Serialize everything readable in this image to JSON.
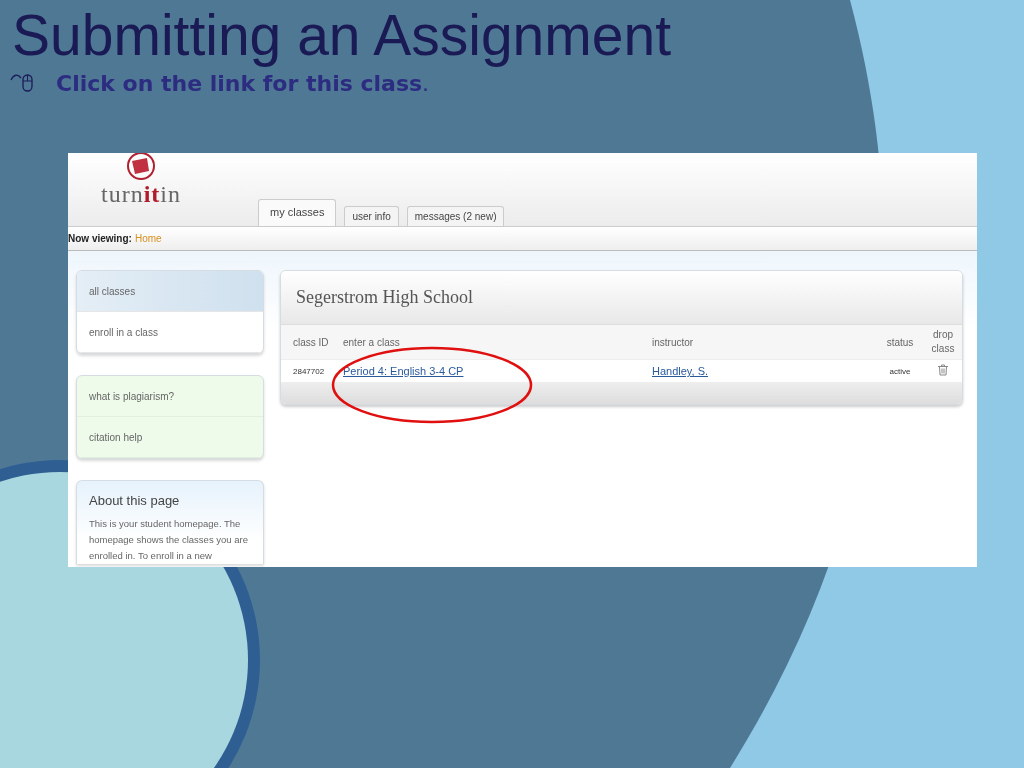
{
  "slide": {
    "title": "Submitting an Assignment",
    "bullet": "**Click on the link for this class**."
  },
  "screenshot": {
    "logo": "turn**it**in",
    "tabs": [
      {
        "label": "my classes",
        "selected": true
      },
      {
        "label": "user info",
        "selected": false
      },
      {
        "label": "messages (2 new)",
        "selected": false
      }
    ],
    "breadcrumb": {
      "label": "Now viewing:",
      "page": "Home"
    },
    "sidebar": {
      "nav": [
        {
          "label": "all classes",
          "selected": true
        },
        {
          "label": "enroll in a class",
          "selected": false
        }
      ],
      "help": [
        "what is plagiarism?",
        "citation help"
      ],
      "about": {
        "title": "About this page",
        "text": "This is your student homepage. The homepage shows the classes you are enrolled in. To enroll in a new"
      }
    },
    "panel": {
      "title": "Segerstrom High School",
      "columns": [
        "class ID",
        "enter a class",
        "instructor",
        "status",
        "drop class"
      ],
      "rows": [
        {
          "class_id": "2847702",
          "class_name": "Period 4: English 3-4 CP",
          "instructor": "Handley, S.",
          "status": "active"
        }
      ]
    }
  }
}
